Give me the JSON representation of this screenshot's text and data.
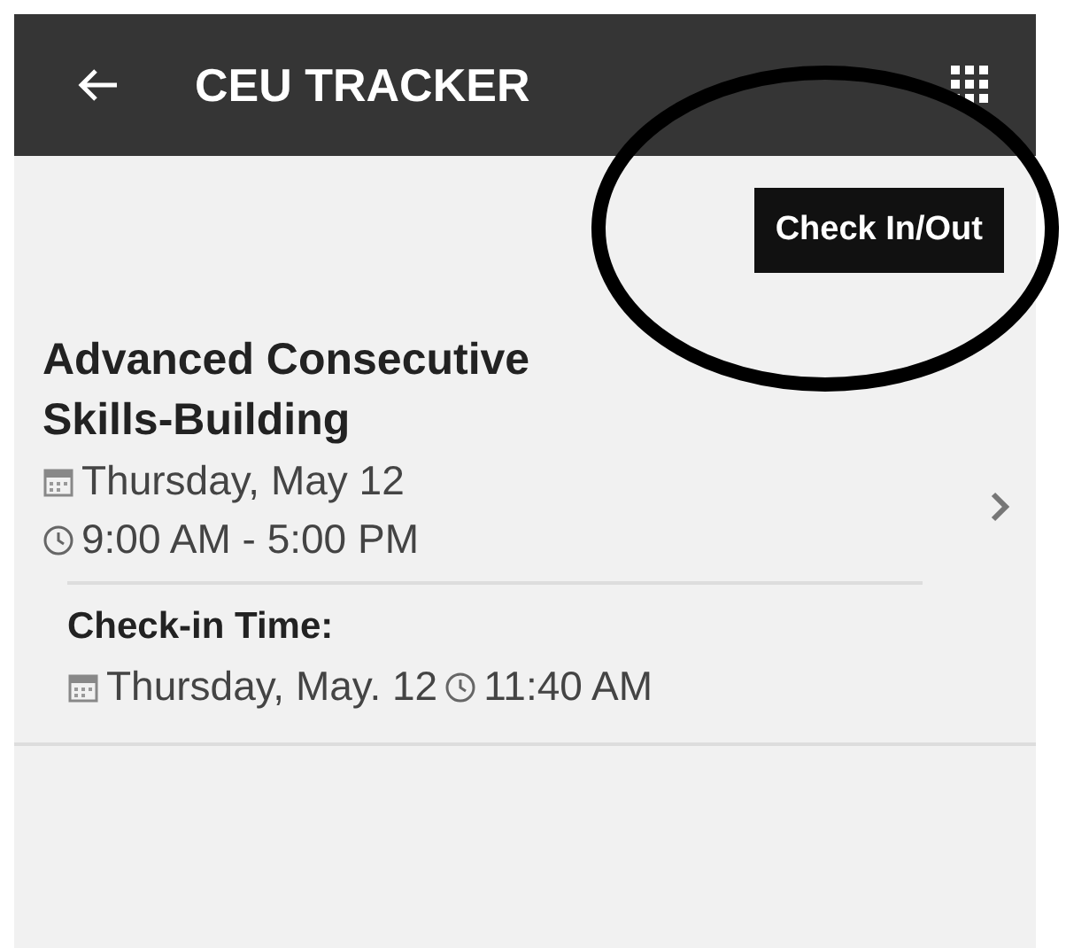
{
  "app_bar": {
    "title": "CEU TRACKER"
  },
  "action_button": {
    "label": "Check In/Out"
  },
  "session": {
    "title": "Advanced Consecutive Skills-Building",
    "date": "Thursday, May 12",
    "time": "9:00 AM - 5:00 PM",
    "checkin_label": "Check-in Time:",
    "checkin_date": "Thursday, May. 12",
    "checkin_time": "11:40 AM"
  }
}
